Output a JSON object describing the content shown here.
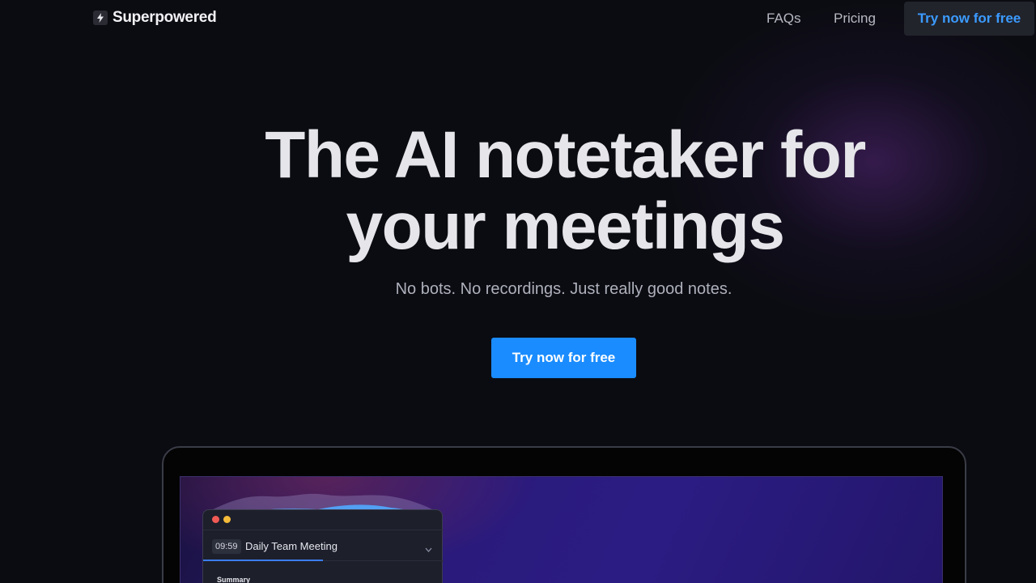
{
  "nav": {
    "logo_text": "Superpowered",
    "links": [
      "FAQs",
      "Pricing"
    ],
    "cta_label": "Try now for free"
  },
  "hero": {
    "title_line1": "The AI notetaker for",
    "title_line2": "your meetings",
    "subtitle": "No bots. No recordings. Just really good notes.",
    "cta_label": "Try now for free"
  },
  "preview": {
    "meeting_time": "09:59",
    "meeting_title": "Daily Team Meeting",
    "section_label": "Summary"
  },
  "colors": {
    "background": "#0b0c12",
    "accent": "#1a8cff",
    "nav_cta_text": "#3b9bff"
  },
  "icons": [
    "bolt-icon",
    "chevron-down-icon"
  ]
}
